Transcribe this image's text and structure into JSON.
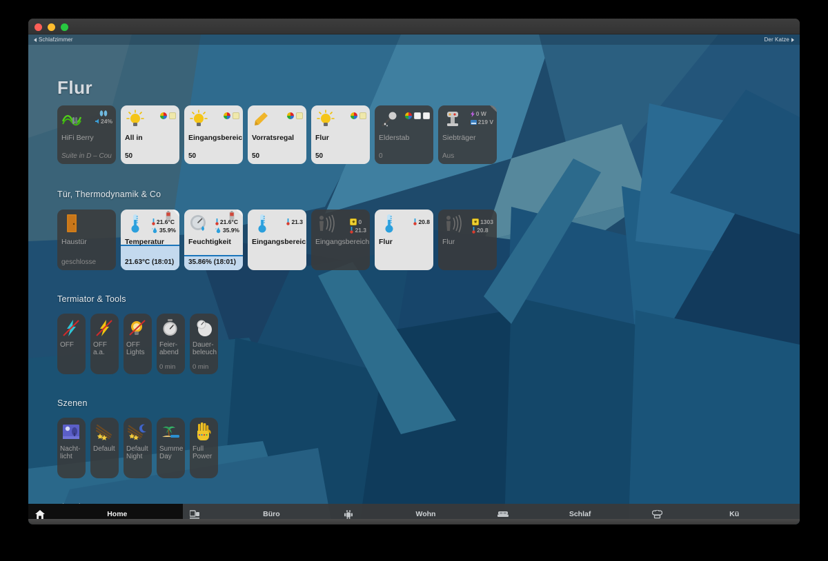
{
  "window": {
    "traffic_lights": [
      "close",
      "minimize",
      "zoom"
    ]
  },
  "topnav": {
    "prev_label": "Schlafzimmer",
    "next_label": "Der Katze"
  },
  "page": {
    "title": "Flur"
  },
  "sections": [
    {
      "id": "lights",
      "title": ""
    },
    {
      "id": "thermo",
      "title": "Tür, Thermodynamik & Co"
    },
    {
      "id": "tools",
      "title": "Termiator & Tools"
    },
    {
      "id": "scenes",
      "title": "Szenen"
    },
    {
      "id": "single",
      "title": "einzelne Lampen"
    }
  ],
  "row_lights": [
    {
      "name": "HiFi Berry",
      "sub": "Suite in D – Cou",
      "state": "off",
      "icon": "audio-wave-icon",
      "badges": [
        {
          "icon": "speaker-icon",
          "text": "24%"
        }
      ],
      "badge_top": "headphones-icon",
      "sub_italic": true
    },
    {
      "name": "All in",
      "sub": "50",
      "state": "on",
      "icon": "lightbulb-icon",
      "chips": [
        "chip-rgb",
        "chip-warm"
      ]
    },
    {
      "name": "Eingangsbereich",
      "sub": "50",
      "state": "on",
      "icon": "lightbulb-icon",
      "chips": [
        "chip-rgb",
        "chip-warm"
      ]
    },
    {
      "name": "Vorratsregal",
      "sub": "50",
      "state": "on",
      "icon": "flashlight-icon",
      "chips": [
        "chip-rgb",
        "chip-warm"
      ]
    },
    {
      "name": "Flur",
      "sub": "50",
      "state": "on",
      "icon": "lightbulb-icon",
      "chips": [
        "chip-rgb",
        "chip-warm"
      ]
    },
    {
      "name": "Elderstab",
      "sub": "0",
      "state": "off",
      "icon": "magic-wand-icon",
      "chips": [
        "chip-rgb",
        "chip-white",
        "chip-white"
      ]
    },
    {
      "name": "Siebträger",
      "sub": "Aus",
      "state": "off",
      "icon": "coffee-machine-icon",
      "badges": [
        {
          "icon": "bolt-icon",
          "text": "0 W"
        },
        {
          "icon": "plug-icon",
          "text": "219 V"
        }
      ],
      "fold": true
    }
  ],
  "row_thermo": [
    {
      "name": "Haustür",
      "sub": "geschlosse",
      "state": "off",
      "icon": "door-icon"
    },
    {
      "name": "Temperatur",
      "sub": "21.63°C (18:01)",
      "state": "on",
      "icon": "thermometer-icon",
      "badges": [
        {
          "icon": "thermometer-small-icon",
          "text": "21.6°C"
        },
        {
          "icon": "humidity-icon",
          "text": "35.9%"
        }
      ],
      "fill_percent": 47,
      "battery": true,
      "fold": true
    },
    {
      "name": "Feuchtigkeit",
      "sub": "35.86% (18:01)",
      "state": "on",
      "icon": "gauge-icon",
      "badges": [
        {
          "icon": "thermometer-small-icon",
          "text": "21.6°C"
        },
        {
          "icon": "humidity-icon",
          "text": "35.9%"
        }
      ],
      "fill_percent": 20,
      "battery": true,
      "fold": true
    },
    {
      "name": "Eingangsbereich",
      "sub": "",
      "state": "on",
      "icon": "thermometer-icon",
      "badges": [
        {
          "icon": "thermometer-small-icon",
          "text": "21.3"
        }
      ]
    },
    {
      "name": "Eingangsbereich",
      "sub": "",
      "state": "off",
      "icon": "motion-sensor-icon",
      "badges": [
        {
          "icon": "brightness-icon",
          "text": "0"
        },
        {
          "icon": "thermometer-small-icon",
          "text": "21.3"
        }
      ]
    },
    {
      "name": "Flur",
      "sub": "",
      "state": "on",
      "icon": "thermometer-icon",
      "badges": [
        {
          "icon": "thermometer-small-icon",
          "text": "20.8"
        }
      ]
    },
    {
      "name": "Flur",
      "sub": "",
      "state": "off",
      "icon": "motion-sensor-icon",
      "badges": [
        {
          "icon": "brightness-icon",
          "text": "1303"
        },
        {
          "icon": "thermometer-small-icon",
          "text": "20.8"
        }
      ]
    }
  ],
  "row_tools": [
    {
      "name": "OFF",
      "sub": "",
      "state": "off",
      "icon": "bolt-crossed-cyan-icon"
    },
    {
      "name": "OFF\na.a.",
      "sub": "",
      "state": "off",
      "icon": "bolt-crossed-yellow-icon"
    },
    {
      "name": "OFF\nLights",
      "sub": "",
      "state": "off",
      "icon": "bulb-crossed-icon"
    },
    {
      "name": "Feier-\nabend",
      "sub": "0 min",
      "state": "off",
      "icon": "stopwatch-icon"
    },
    {
      "name": "Dauer-\nbeleuch",
      "sub": "0 min",
      "state": "off",
      "icon": "clock-bulb-icon"
    }
  ],
  "row_scenes": [
    {
      "name": "Nacht-\nlicht",
      "sub": "",
      "state": "off",
      "icon": "night-picture-icon"
    },
    {
      "name": "Default",
      "sub": "",
      "state": "off",
      "icon": "sparkles-icon"
    },
    {
      "name": "Default\nNight",
      "sub": "",
      "state": "off",
      "icon": "sparkles-moon-icon"
    },
    {
      "name": "Summe\nDay",
      "sub": "",
      "state": "off",
      "icon": "beach-icon"
    },
    {
      "name": "Full\nPower",
      "sub": "",
      "state": "off",
      "icon": "gauntlet-icon"
    }
  ],
  "tabs": [
    {
      "label": "Home",
      "icon": "home-icon",
      "active": true
    },
    {
      "label": "Büro",
      "icon": "office-icon",
      "active": false
    },
    {
      "label": "Wohn",
      "icon": "sofa-icon",
      "active": false
    },
    {
      "label": "Schlaf",
      "icon": "bed-icon",
      "active": false
    },
    {
      "label": "Kü",
      "icon": "chefhat-icon",
      "active": false
    }
  ],
  "colors": {
    "accent_blue": "#1b75bb",
    "fill_blue": "#c3d9ee",
    "tile_on": "#e3e3e3",
    "tile_off": "#3a3a3a",
    "bg_base": "#1d4160"
  }
}
